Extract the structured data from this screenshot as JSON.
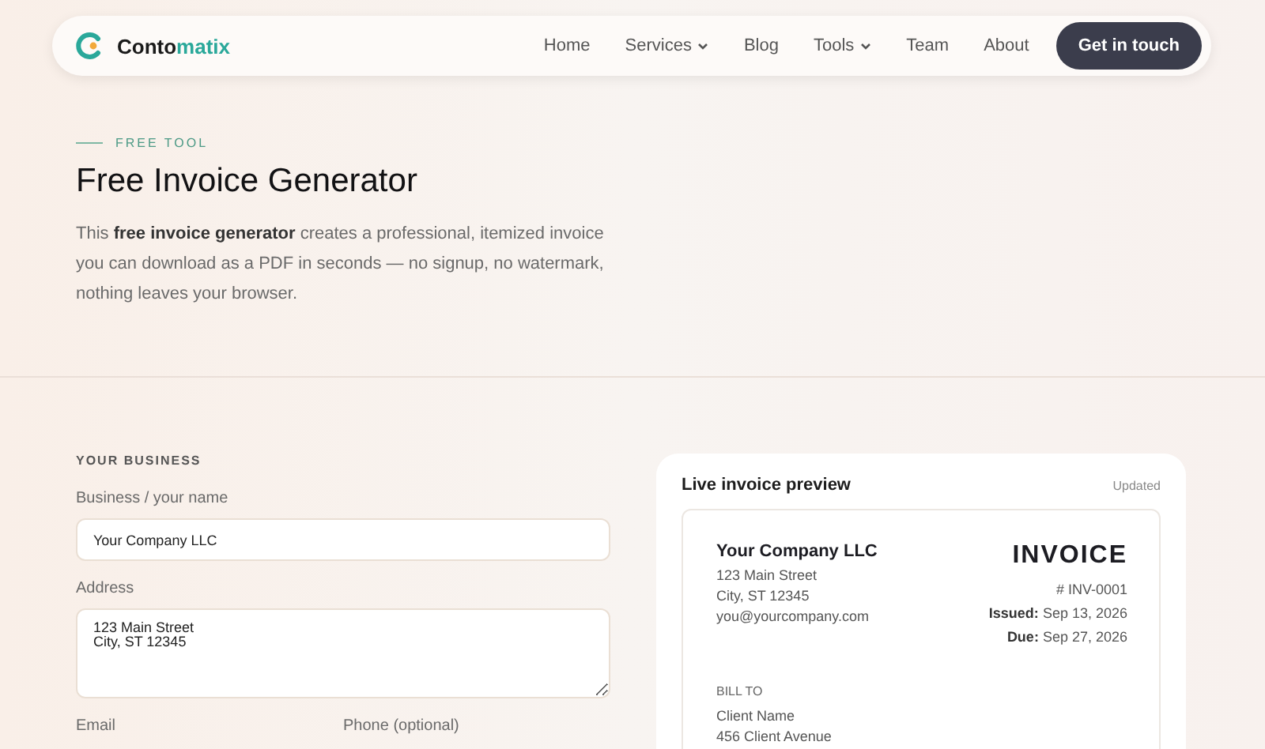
{
  "nav": {
    "logo": {
      "part_1": "Conto",
      "part_2": "matix"
    },
    "items": [
      {
        "label": "Home",
        "dropdown": false
      },
      {
        "label": "Services",
        "dropdown": true
      },
      {
        "label": "Blog",
        "dropdown": false
      },
      {
        "label": "Tools",
        "dropdown": true
      },
      {
        "label": "Team",
        "dropdown": false
      },
      {
        "label": "About",
        "dropdown": false
      }
    ],
    "cta": "Get in touch"
  },
  "hero": {
    "eyebrow": "FREE TOOL",
    "title": "Free Invoice Generator",
    "intro": "This **free invoice generator** creates a professional, itemized invoice you can download as a PDF in seconds — no signup, no watermark, nothing leaves your browser."
  },
  "form": {
    "section": "YOUR BUSINESS",
    "fields": [
      {
        "label": "Business / your name",
        "kind": "input",
        "value": "Your Company LLC"
      },
      {
        "label": "Address",
        "kind": "textarea",
        "value": "123 Main Street\nCity, ST 12345"
      }
    ],
    "next_labels": [
      "Email",
      "Phone (optional)"
    ]
  },
  "preview": {
    "title": "Live invoice preview",
    "status": "Updated",
    "invoice": {
      "from_name": "Your Company LLC",
      "from_lines": [
        "123 Main Street",
        "City, ST 12345",
        "you@yourcompany.com"
      ],
      "heading": "INVOICE",
      "number": "# INV-0001",
      "dates": [
        {
          "label": "Issued:",
          "value": "Sep 13, 2026"
        },
        {
          "label": "Due:",
          "value": "Sep 27, 2026"
        }
      ],
      "bill_to": "BILL TO",
      "client_lines": [
        "Client Name",
        "456 Client Avenue"
      ]
    }
  }
}
